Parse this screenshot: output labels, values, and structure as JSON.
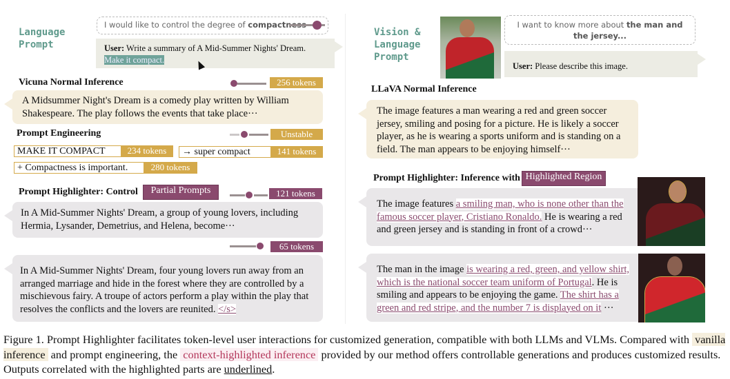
{
  "left": {
    "label": "Language Prompt",
    "control_hint_prefix": "I would like to control the degree of ",
    "control_hint_bold": "compactness",
    "user_prefix": "User:",
    "user_text": " Write a summary of A Mid-Summer Nights' Dream. ",
    "user_highlight": "Make it compact.",
    "vicuna": {
      "title": "Vicuna Normal Inference",
      "tokens": "256 tokens",
      "text": "A Midsummer Night's Dream is a comedy play written by William Shakespeare. The play follows the events that take place···"
    },
    "prompt_eng": {
      "title": "Prompt Engineering",
      "status": "Unstable",
      "variants": [
        {
          "text": "MAKE IT COMPACT",
          "tokens": "234 tokens"
        },
        {
          "text": "→ super compact",
          "tokens": "141 tokens"
        },
        {
          "text": "+ Compactness is important.",
          "tokens": "280 tokens"
        }
      ]
    },
    "highlighter": {
      "title": "Prompt Highlighter: Control",
      "badge": "Partial Prompts",
      "tokens1": "121 tokens",
      "text1": "In A Mid-Summer Nights' Dream, a group of young lovers, including Hermia, Lysander, Demetrius, and Helena, become···",
      "tokens2": "65 tokens",
      "text2": "In A Mid-Summer Nights' Dream, four young lovers run away from an arranged marriage and hide in the forest where they are controlled by a mischievous fairy. A troupe of actors perform a play within the play that resolves the conflicts and the lovers are reunited. ",
      "eos": "</s>"
    }
  },
  "right": {
    "label": "Vision & Language Prompt",
    "hint_prefix": "I want to know more about ",
    "hint_bold": "the man and the jersey...",
    "user_prefix": "User:",
    "user_text": " Please describe this image.",
    "llava": {
      "title": "LLaVA Normal Inference",
      "text": "The image features a man wearing a red and green soccer jersey, smiling and posing for a picture. He is likely a soccer player, as he is wearing a sports uniform and is standing on a field. The man appears to be enjoying himself···"
    },
    "highlighter": {
      "title": "Prompt Highlighter: Inference with",
      "badge": "Highlighted Region",
      "r1": [
        "The image features ",
        "a smiling man, who is none other than the famous soccer player, Cristiano Ronaldo.",
        " He is wearing a red and green jersey and is standing in front of a crowd···"
      ],
      "r2": [
        "The man in the image ",
        "is wearing a red, green, and yellow shirt, which is the national soccer team uniform of Portugal",
        ". He is smiling and appears to be enjoying the game. ",
        "The shirt has a green and red stripe, and the number 7 is displayed on it",
        " ···"
      ]
    }
  },
  "caption": {
    "p1": "Figure 1. Prompt Highlighter facilitates token-level user interactions for customized generation, compatible with both LLMs and VLMs. Compared with ",
    "vanilla": "vanilla inference",
    "p2": " and prompt engineering, the ",
    "context": "context-highlighted inference",
    "p3": " provided by our method offers controllable generations and produces customized results. Outputs correlated with the highlighted parts are ",
    "underlined": "underlined",
    "p4": "."
  },
  "colors": {
    "gold": "#d4a94a",
    "purple": "#8a4a6e",
    "teal": "#5f9a8c"
  }
}
